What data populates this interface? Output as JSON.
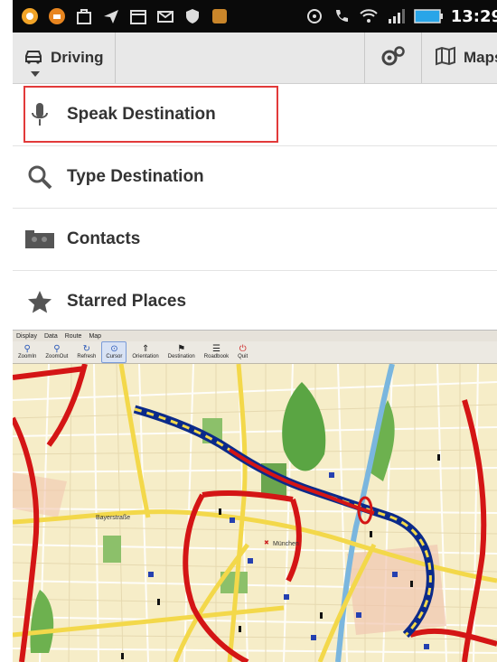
{
  "statusbar": {
    "time": "13:29",
    "icons": [
      "notification-icon",
      "notification-icon",
      "bag-icon",
      "send-icon",
      "calendar-icon",
      "mail-icon",
      "shield-icon",
      "app-icon",
      "sync-icon",
      "phone-icon",
      "wifi-icon",
      "signal-icon",
      "battery-icon"
    ]
  },
  "actionbar": {
    "mode_label": "Driving",
    "maps_label": "Maps"
  },
  "menu": {
    "items": [
      {
        "label": "Speak Destination",
        "icon": "microphone-icon"
      },
      {
        "label": "Type Destination",
        "icon": "search-icon"
      },
      {
        "label": "Contacts",
        "icon": "contacts-icon"
      },
      {
        "label": "Starred Places",
        "icon": "star-icon"
      }
    ]
  },
  "map_app": {
    "menubar": [
      "Display",
      "Data",
      "Route",
      "Map"
    ],
    "toolbar": [
      {
        "label": "ZoomIn",
        "glyph": "🔍"
      },
      {
        "label": "ZoomOut",
        "glyph": "🔍"
      },
      {
        "label": "Refresh",
        "glyph": "↻"
      },
      {
        "label": "Cursor",
        "glyph": "⊙"
      },
      {
        "label": "Orientation",
        "glyph": "⇑"
      },
      {
        "label": "Destination",
        "glyph": "⚑"
      },
      {
        "label": "Roadbook",
        "glyph": "☰"
      },
      {
        "label": "Quit",
        "glyph": "⏻"
      }
    ],
    "place_label": "München",
    "street_labels": [
      "Bayerstraße"
    ]
  },
  "colors": {
    "highlight": "#e23a3a",
    "route": "#0b2a8a",
    "main_road": "#d41515",
    "park": "#4f9a3a",
    "river": "#6ab0d8"
  }
}
